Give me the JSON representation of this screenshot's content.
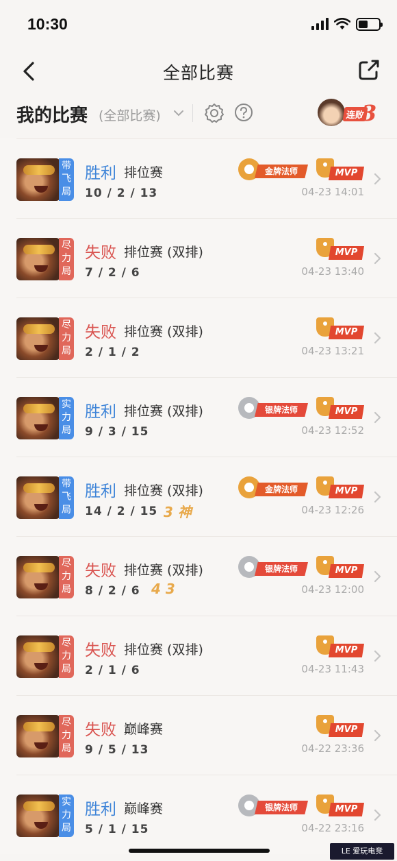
{
  "status_bar": {
    "time": "10:30",
    "battery_level": 0.45,
    "icons": [
      "signal-icon",
      "wifi-icon",
      "battery-icon"
    ]
  },
  "nav": {
    "title": "全部比赛",
    "back_icon": "chevron-left-icon",
    "share_icon": "share-icon"
  },
  "filter": {
    "my_matches": "我的比赛",
    "current_filter": "(全部比赛)",
    "chevron_icon": "chevron-down-icon",
    "settings_icon": "gear-icon",
    "help_icon": "question-icon",
    "streak_label": "连败",
    "streak_count": "3"
  },
  "colors": {
    "win": "#3e84d8",
    "lose": "#d9534f",
    "tag_blue": "#4a8ee6",
    "tag_red": "#e0675a",
    "mvp_red": "#e2472f",
    "gold": "#e9a23b"
  },
  "matches": [
    {
      "tag": "带飞局",
      "tag_color": "blue",
      "result": "胜利",
      "outcome": "win",
      "mode": "排位赛",
      "kda": "10 / 2 / 13",
      "extra": "",
      "medal": "金牌法师",
      "medal_type": "gold",
      "mvp": "MVP",
      "time": "04-23 14:01"
    },
    {
      "tag": "尽力局",
      "tag_color": "red",
      "result": "失败",
      "outcome": "lose",
      "mode": "排位赛 (双排)",
      "kda": "7 / 2 / 6",
      "extra": "",
      "medal": "",
      "medal_type": "",
      "mvp": "MVP",
      "time": "04-23 13:40"
    },
    {
      "tag": "尽力局",
      "tag_color": "red",
      "result": "失败",
      "outcome": "lose",
      "mode": "排位赛 (双排)",
      "kda": "2 / 1 / 2",
      "extra": "",
      "medal": "",
      "medal_type": "",
      "mvp": "MVP",
      "time": "04-23 13:21"
    },
    {
      "tag": "实力局",
      "tag_color": "blue",
      "result": "胜利",
      "outcome": "win",
      "mode": "排位赛 (双排)",
      "kda": "9 / 3 / 15",
      "extra": "",
      "medal": "银牌法师",
      "medal_type": "silver",
      "mvp": "MVP",
      "time": "04-23 12:52"
    },
    {
      "tag": "带飞局",
      "tag_color": "blue",
      "result": "胜利",
      "outcome": "win",
      "mode": "排位赛 (双排)",
      "kda": "14 / 2 / 15",
      "extra": "3 神",
      "medal": "金牌法师",
      "medal_type": "gold",
      "mvp": "MVP",
      "time": "04-23 12:26"
    },
    {
      "tag": "尽力局",
      "tag_color": "red",
      "result": "失败",
      "outcome": "lose",
      "mode": "排位赛 (双排)",
      "kda": "8 / 2 / 6",
      "extra": "4 3",
      "medal": "银牌法师",
      "medal_type": "silver",
      "mvp": "MVP",
      "time": "04-23 12:00"
    },
    {
      "tag": "尽力局",
      "tag_color": "red",
      "result": "失败",
      "outcome": "lose",
      "mode": "排位赛 (双排)",
      "kda": "2 / 1 / 6",
      "extra": "",
      "medal": "",
      "medal_type": "",
      "mvp": "MVP",
      "time": "04-23 11:43"
    },
    {
      "tag": "尽力局",
      "tag_color": "red",
      "result": "失败",
      "outcome": "lose",
      "mode": "巅峰赛",
      "kda": "9 / 5 / 13",
      "extra": "",
      "medal": "",
      "medal_type": "",
      "mvp": "MVP",
      "time": "04-22 23:36"
    },
    {
      "tag": "实力局",
      "tag_color": "blue",
      "result": "胜利",
      "outcome": "win",
      "mode": "巅峰赛",
      "kda": "5 / 1 / 15",
      "extra": "",
      "medal": "银牌法师",
      "medal_type": "silver",
      "mvp": "MVP",
      "time": "04-22 23:16"
    }
  ]
}
